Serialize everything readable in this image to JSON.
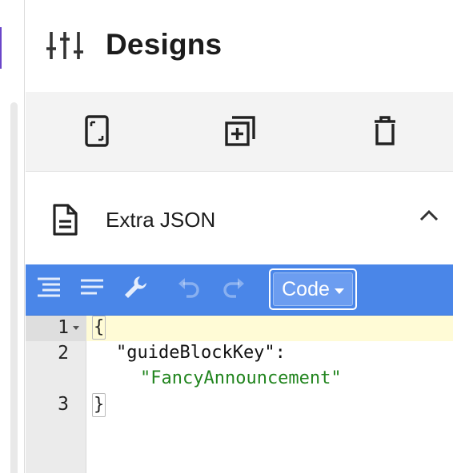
{
  "panel": {
    "title": "Designs",
    "title_icon": "sliders-icon"
  },
  "toolbar": {
    "buttons": [
      {
        "name": "device-preview-button",
        "icon": "mobile-device-icon"
      },
      {
        "name": "duplicate-button",
        "icon": "add-copy-icon"
      },
      {
        "name": "delete-button",
        "icon": "trash-icon"
      }
    ]
  },
  "section": {
    "label": "Extra JSON",
    "icon": "document-icon",
    "expanded": true
  },
  "editor": {
    "menu": [
      {
        "name": "format-button",
        "icon": "format-indent-icon"
      },
      {
        "name": "compact-button",
        "icon": "compact-lines-icon"
      },
      {
        "name": "repair-button",
        "icon": "wrench-icon"
      },
      {
        "name": "undo-button",
        "icon": "undo-icon",
        "enabled": false
      },
      {
        "name": "redo-button",
        "icon": "redo-icon",
        "enabled": false
      }
    ],
    "mode": "Code",
    "line_numbers": [
      "1",
      "2",
      "3"
    ],
    "lines": {
      "open_brace": "{",
      "key": "\"guideBlockKey\":",
      "value": "\"FancyAnnouncement\"",
      "close_brace": "}"
    },
    "colors": {
      "menu_bg": "#4a86e8",
      "string": "#22851f",
      "active_line": "#fffbd6"
    }
  }
}
